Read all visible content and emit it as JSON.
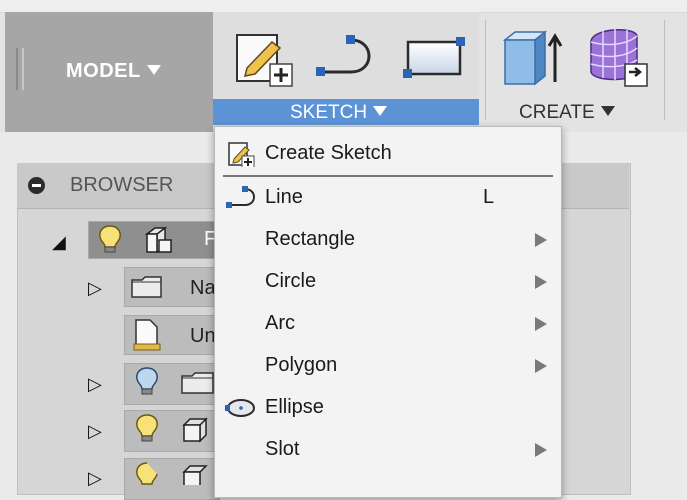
{
  "toolbar": {
    "model_label": "MODEL",
    "sketch_label": "SKETCH",
    "create_label": "CREATE",
    "sketch_tools": [
      "create-sketch-icon",
      "line-icon",
      "rectangle-icon"
    ],
    "create_tools": [
      "extrude-icon",
      "form-icon"
    ],
    "accent_color": "#5b93d6"
  },
  "browser": {
    "title": "BROWSER",
    "rows": [
      {
        "label": "F",
        "icons": [
          "lightbulb-icon",
          "component-icon"
        ],
        "selected": true
      },
      {
        "label": "Na",
        "icons": [
          "folder-icon"
        ]
      },
      {
        "label": "Un",
        "icons": [
          "units-doc-icon"
        ]
      },
      {
        "label": "",
        "icons": [
          "lightbulb-icon",
          "folder-icon"
        ]
      },
      {
        "label": "",
        "icons": [
          "lightbulb-icon",
          "body-icon"
        ]
      },
      {
        "label": "",
        "icons": [
          "lightbulb-icon",
          "body-icon"
        ]
      }
    ]
  },
  "menu": {
    "items": [
      {
        "label": "Create Sketch",
        "icon": "create-sketch-icon"
      },
      {
        "label": "Line",
        "shortcut": "L",
        "icon": "line-icon"
      },
      {
        "label": "Rectangle",
        "submenu": true
      },
      {
        "label": "Circle",
        "submenu": true
      },
      {
        "label": "Arc",
        "submenu": true
      },
      {
        "label": "Polygon",
        "submenu": true
      },
      {
        "label": "Ellipse",
        "icon": "ellipse-icon"
      },
      {
        "label": "Slot",
        "submenu": true
      }
    ]
  }
}
